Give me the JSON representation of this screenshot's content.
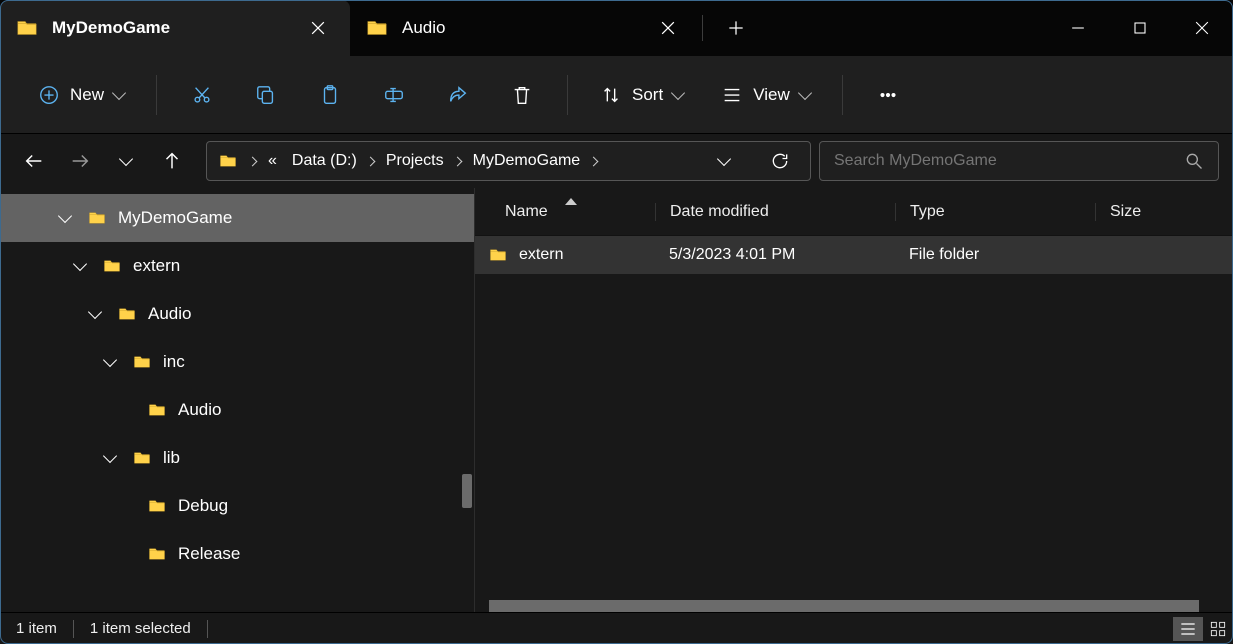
{
  "tabs": [
    {
      "title": "MyDemoGame",
      "active": true
    },
    {
      "title": "Audio",
      "active": false
    }
  ],
  "toolbar": {
    "new_label": "New",
    "sort_label": "Sort",
    "view_label": "View"
  },
  "breadcrumb": [
    "«",
    "Data (D:)",
    "Projects",
    "MyDemoGame"
  ],
  "search": {
    "placeholder": "Search MyDemoGame"
  },
  "tree": [
    {
      "label": "MyDemoGame",
      "depth": 0,
      "expanded": true,
      "selected": true
    },
    {
      "label": "extern",
      "depth": 1,
      "expanded": true
    },
    {
      "label": "Audio",
      "depth": 2,
      "expanded": true
    },
    {
      "label": "inc",
      "depth": 3,
      "expanded": true
    },
    {
      "label": "Audio",
      "depth": 4,
      "expanded": false,
      "leaf": true
    },
    {
      "label": "lib",
      "depth": 3,
      "expanded": true
    },
    {
      "label": "Debug",
      "depth": 4,
      "expanded": false,
      "leaf": true
    },
    {
      "label": "Release",
      "depth": 4,
      "expanded": false,
      "leaf": true
    }
  ],
  "columns": {
    "name": "Name",
    "date": "Date modified",
    "type": "Type",
    "size": "Size"
  },
  "rows": [
    {
      "name": "extern",
      "date": "5/3/2023 4:01 PM",
      "type": "File folder",
      "size": ""
    }
  ],
  "status": {
    "count": "1 item",
    "selection": "1 item selected"
  }
}
